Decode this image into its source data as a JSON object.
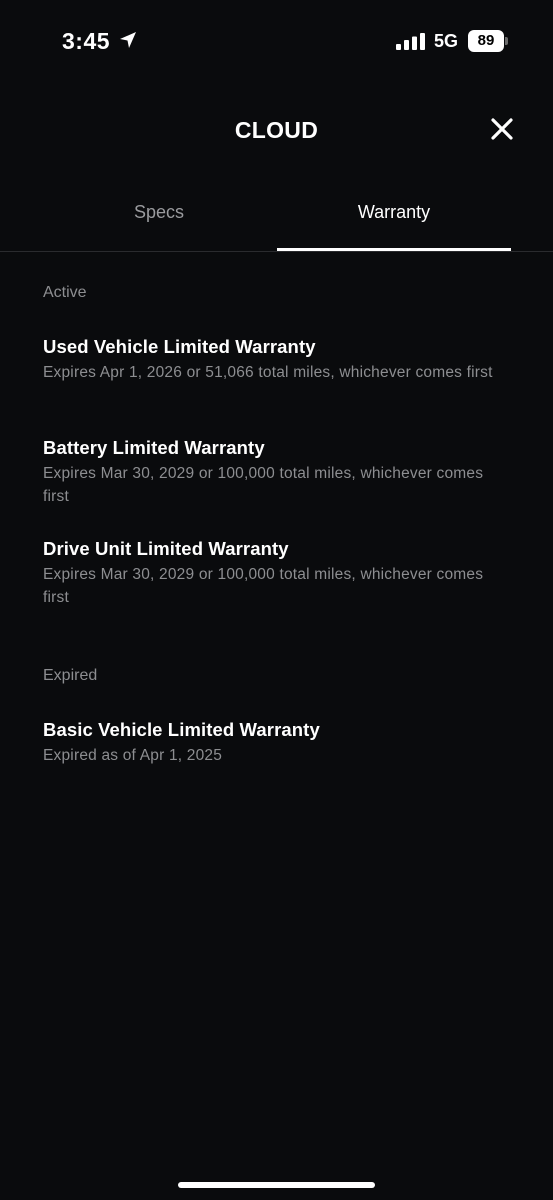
{
  "status_bar": {
    "time": "3:45",
    "network": "5G",
    "battery": "89"
  },
  "header": {
    "title": "CLOUD"
  },
  "tabs": [
    {
      "label": "Specs",
      "active": false
    },
    {
      "label": "Warranty",
      "active": true
    }
  ],
  "sections": {
    "active": {
      "heading": "Active",
      "items": [
        {
          "title": "Used Vehicle Limited Warranty",
          "subtitle": "Expires Apr 1, 2026 or 51,066 total miles, whichever comes first"
        },
        {
          "title": "Battery Limited Warranty",
          "subtitle": "Expires Mar 30, 2029 or 100,000 total miles, whichever comes first"
        },
        {
          "title": "Drive Unit Limited Warranty",
          "subtitle": "Expires Mar 30, 2029 or 100,000 total miles, whichever comes first"
        }
      ]
    },
    "expired": {
      "heading": "Expired",
      "items": [
        {
          "title": "Basic Vehicle Limited Warranty",
          "subtitle": "Expired as of Apr 1, 2025"
        }
      ]
    }
  },
  "colors": {
    "background": "#0a0b0d",
    "primary_text": "#ffffff",
    "secondary_text": "#8d8e91",
    "inactive_tab": "#9a9b9e"
  },
  "icons": {
    "location": "location-arrow-icon",
    "signal": "cellular-signal-icon",
    "close": "close-icon"
  }
}
